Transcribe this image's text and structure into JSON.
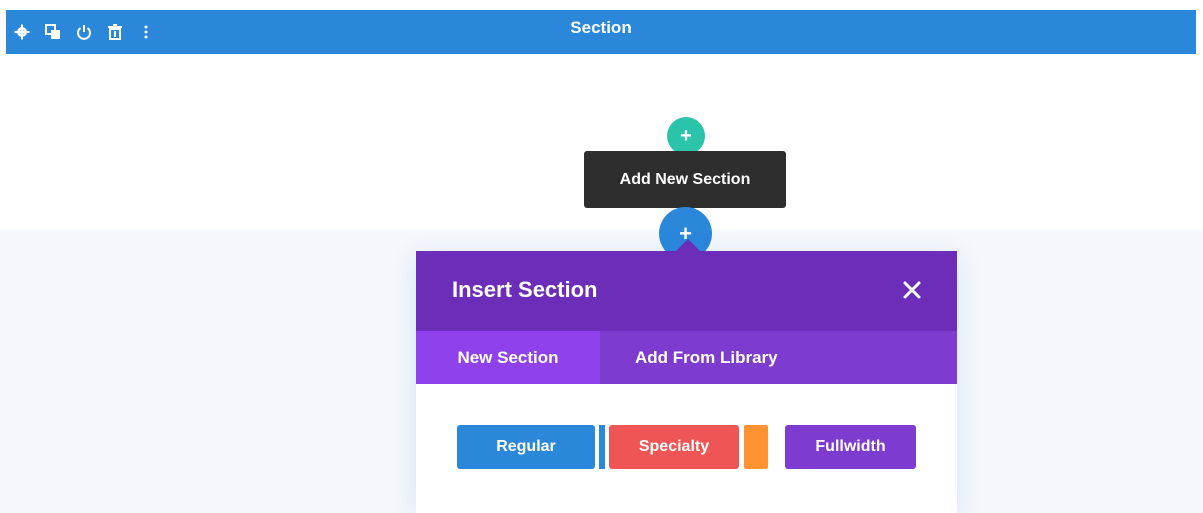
{
  "topbar": {
    "title": "Section",
    "background": "#2b87da",
    "icons": [
      "gear-icon",
      "duplicate-icon",
      "power-icon",
      "trash-icon",
      "more-vertical-icon"
    ]
  },
  "add_buttons": {
    "green_symbol": "+",
    "blue_symbol": "+"
  },
  "tooltip": {
    "text": "Add New Section"
  },
  "modal": {
    "title": "Insert Section",
    "close_symbol": "✕",
    "tabs": [
      {
        "label": "New Section",
        "active": true
      },
      {
        "label": "Add From Library",
        "active": false
      }
    ],
    "section_types": [
      {
        "label": "Regular",
        "color": "#2b87da"
      },
      {
        "label": "Specialty",
        "color": "#ef5555"
      },
      {
        "label": "Fullwidth",
        "color": "#7e3bd0"
      }
    ]
  },
  "colors": {
    "header_purple": "#6c2eb9",
    "tab_purple": "#7e3bd0",
    "active_tab": "#8f42ec",
    "green_add": "#29c4a9",
    "orange_accent": "#ff9232"
  }
}
